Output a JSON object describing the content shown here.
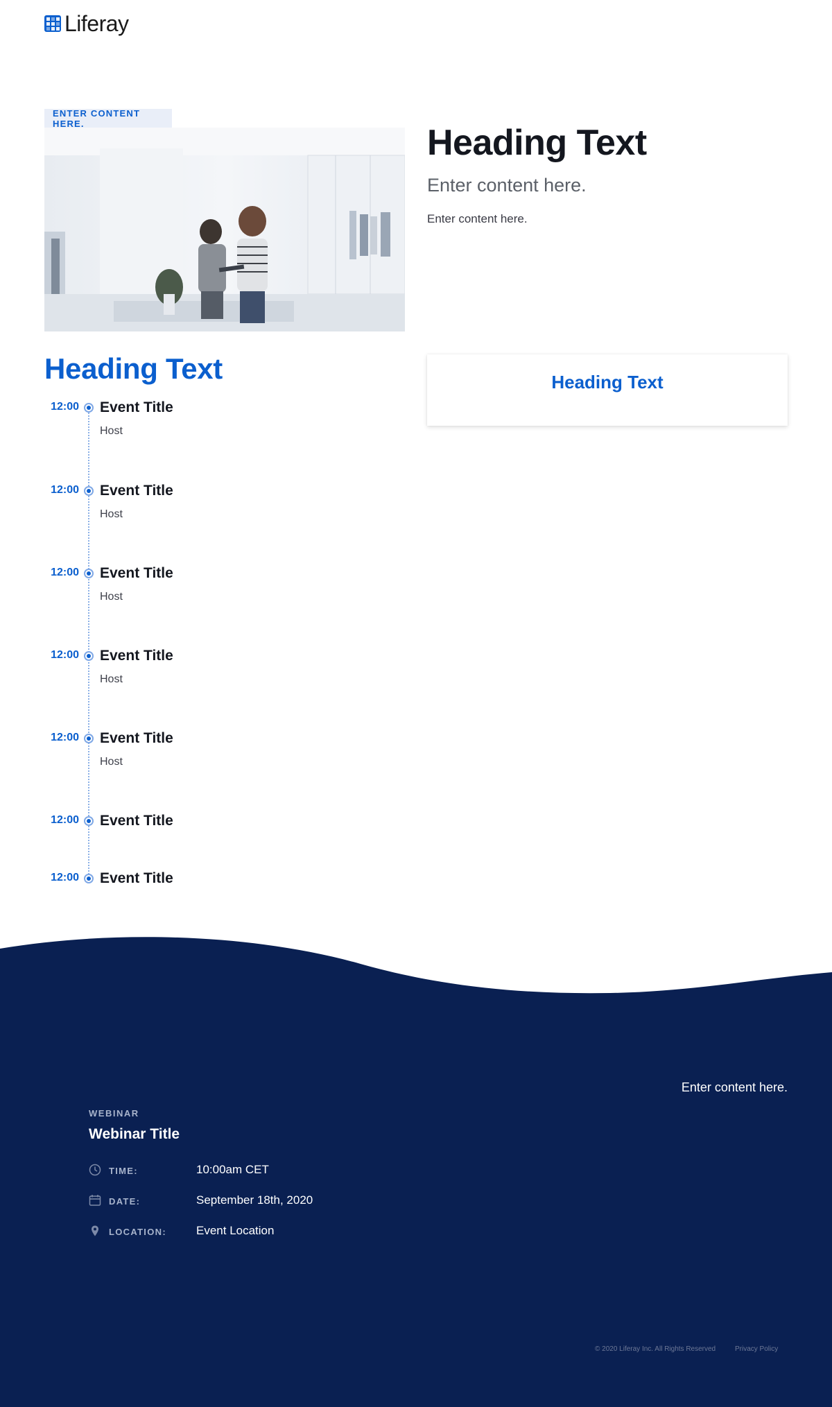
{
  "brand": {
    "name": "Liferay",
    "color": "#0b5fce"
  },
  "hero": {
    "chip_label": "ENTER CONTENT HERE.",
    "heading": "Heading Text",
    "lead": "Enter content here.",
    "body": "Enter content here."
  },
  "agenda": {
    "heading": "Heading Text",
    "items": [
      {
        "time": "12:00",
        "title": "Event Title",
        "host": "Host"
      },
      {
        "time": "12:00",
        "title": "Event Title",
        "host": "Host"
      },
      {
        "time": "12:00",
        "title": "Event Title",
        "host": "Host"
      },
      {
        "time": "12:00",
        "title": "Event Title",
        "host": "Host"
      },
      {
        "time": "12:00",
        "title": "Event Title",
        "host": "Host"
      },
      {
        "time": "12:00",
        "title": "Event Title"
      },
      {
        "time": "12:00",
        "title": "Event Title"
      }
    ]
  },
  "card": {
    "title": "Heading Text"
  },
  "footer": {
    "background": "#0a2052",
    "note": "Enter content here.",
    "webinar": {
      "kicker": "WEBINAR",
      "title": "Webinar Title",
      "time_label": "TIME:",
      "time_value": "10:00am CET",
      "date_label": "DATE:",
      "date_value": "September 18th, 2020",
      "location_label": "LOCATION:",
      "location_value": "Event Location"
    },
    "legal": "© 2020 Liferay Inc. All Rights Reserved",
    "privacy": "Privacy Policy"
  }
}
